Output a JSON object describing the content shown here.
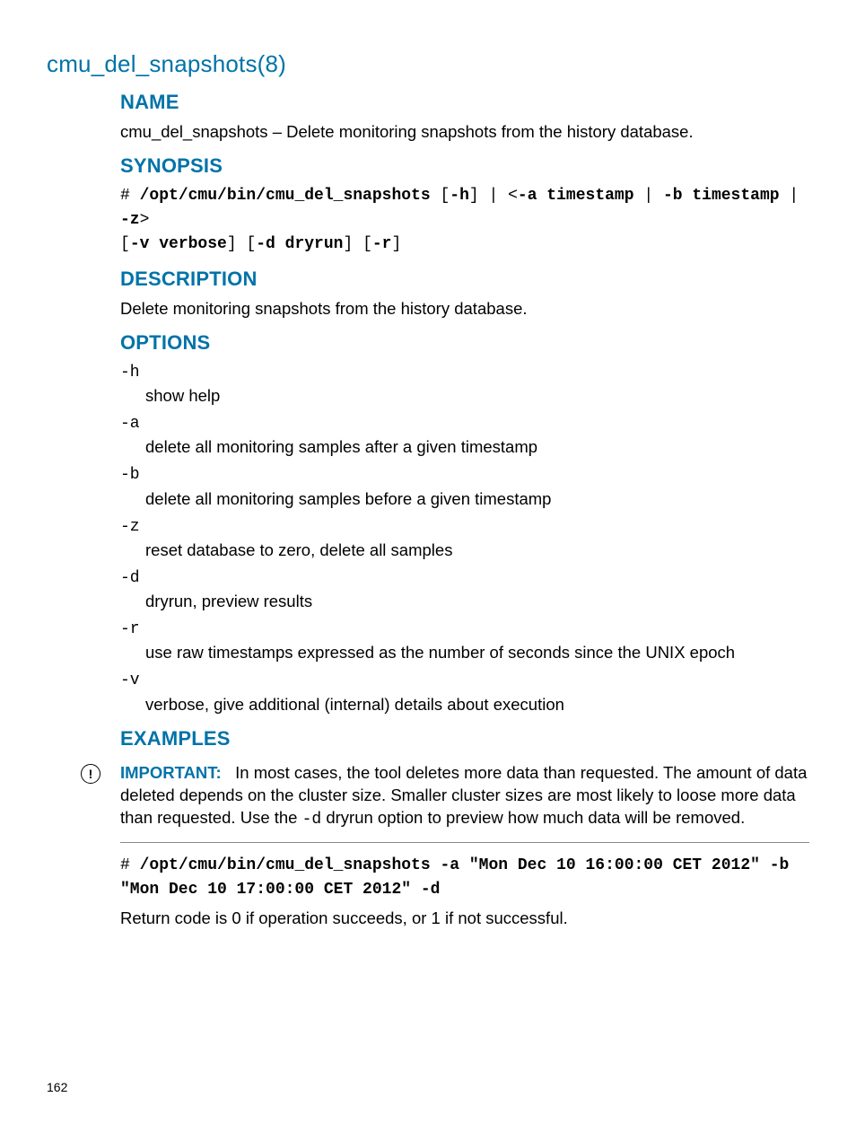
{
  "pageTitle": "cmu_del_snapshots(8)",
  "name": {
    "heading": "NAME",
    "text": "cmu_del_snapshots – Delete monitoring snapshots from the history database."
  },
  "synopsis": {
    "heading": "SYNOPSIS",
    "hash": "# ",
    "cmd": "/opt/cmu/bin/cmu_del_snapshots",
    "p1a": " [",
    "p1b": "-h",
    "p1c": "] | <",
    "p1d": "-a timestamp",
    "p1e": " | ",
    "p1f": "-b timestamp",
    "p1g": " | ",
    "p1h": "-z",
    "p1i": ">",
    "p2a": "[",
    "p2b": "-v verbose",
    "p2c": "] [",
    "p2d": "-d dryrun",
    "p2e": "] [",
    "p2f": "-r",
    "p2g": "]"
  },
  "description": {
    "heading": "DESCRIPTION",
    "text": "Delete monitoring snapshots from the history database."
  },
  "options": {
    "heading": "OPTIONS",
    "items": [
      {
        "flag": "-h",
        "desc": "show help"
      },
      {
        "flag": "-a",
        "desc": "delete all monitoring samples after a given timestamp"
      },
      {
        "flag": "-b",
        "desc": "delete all monitoring samples before a given timestamp"
      },
      {
        "flag": "-z",
        "desc": "reset database to zero, delete all samples"
      },
      {
        "flag": "-d",
        "desc": "dryrun, preview results"
      },
      {
        "flag": "-r",
        "desc": "use raw timestamps expressed as the number of seconds since the UNIX epoch"
      },
      {
        "flag": "-v",
        "desc": "verbose, give additional (internal) details about execution"
      }
    ]
  },
  "examples": {
    "heading": "EXAMPLES",
    "important": {
      "label": "IMPORTANT:",
      "textA": "In most cases, the tool deletes more data than requested. The amount of data deleted depends on the cluster size. Smaller cluster sizes are most likely to loose more data than requested. Use the ",
      "flag": "-d",
      "textB": " dryrun option to preview how much data will be removed."
    },
    "code": {
      "hash": "# ",
      "cmd": "/opt/cmu/bin/cmu_del_snapshots -a \"Mon Dec 10 16:00:00 CET 2012\" -b \"Mon Dec 10 17:00:00 CET 2012\" -d"
    },
    "returnText": "Return code is 0 if operation succeeds, or 1 if not successful."
  },
  "pageNumber": "162"
}
